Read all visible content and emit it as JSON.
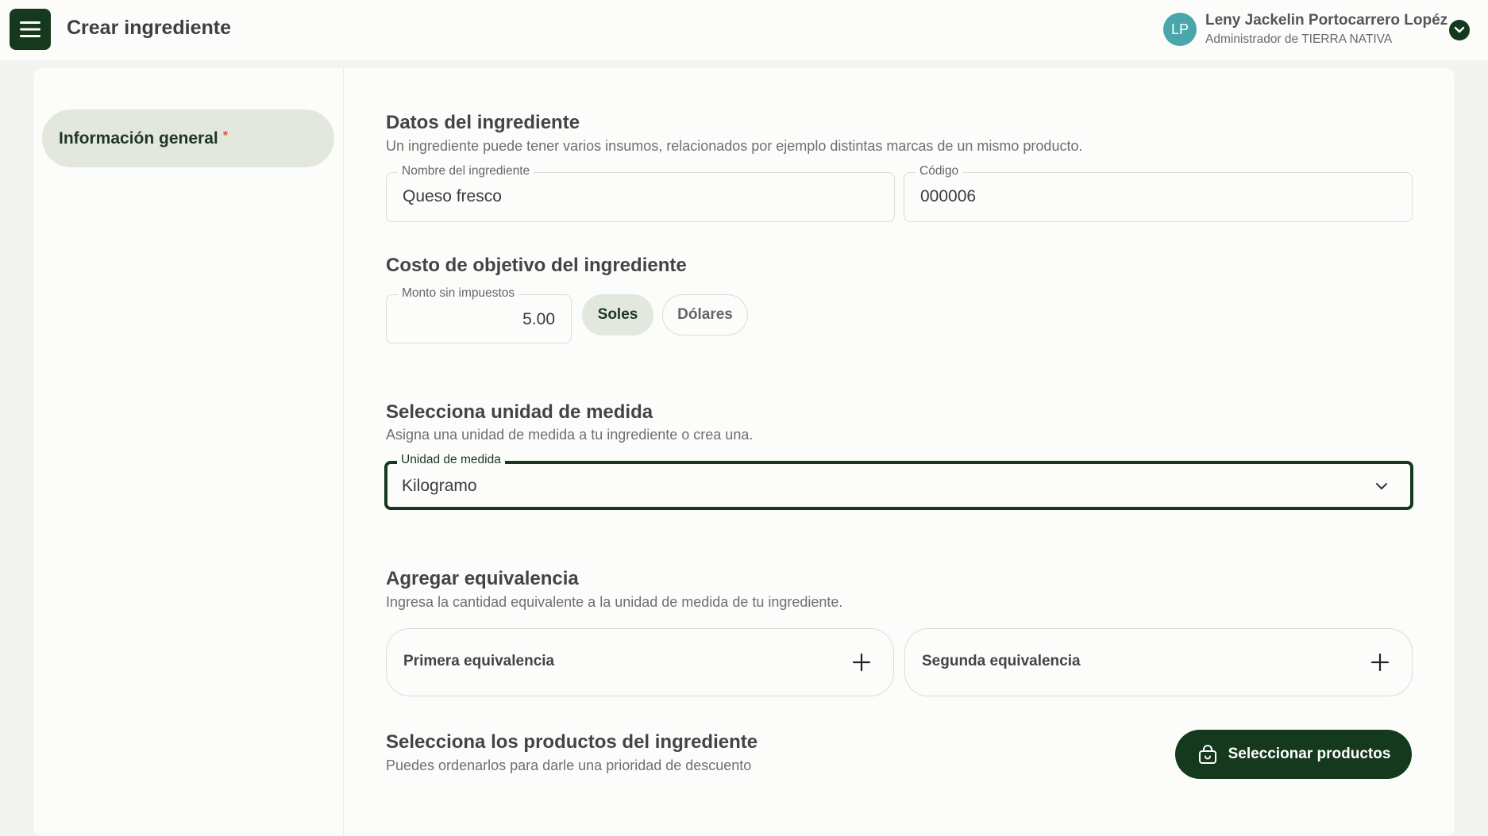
{
  "header": {
    "title": "Crear ingrediente",
    "user": {
      "initials": "LP",
      "name": "Leny Jackelin Portocarrero Lopéz",
      "role": "Administrador de TIERRA NATIVA"
    }
  },
  "sidebar": {
    "items": [
      {
        "label": "Información general",
        "required_mark": "*"
      }
    ]
  },
  "sections": {
    "datos": {
      "title": "Datos del ingrediente",
      "subtitle": "Un ingrediente puede tener varios insumos, relacionados por ejemplo distintas marcas de un mismo producto.",
      "nombre": {
        "label": "Nombre del ingrediente",
        "value": "Queso fresco"
      },
      "codigo": {
        "label": "Código",
        "value": "000006"
      }
    },
    "costo": {
      "title": "Costo de objetivo del ingrediente",
      "monto": {
        "label": "Monto sin impuestos",
        "value": "5.00"
      },
      "currency_options": [
        "Soles",
        "Dólares"
      ],
      "selected_currency": "Soles"
    },
    "unidad": {
      "title": "Selecciona unidad de medida",
      "subtitle": "Asigna una unidad de medida a tu ingrediente o crea una.",
      "select": {
        "label": "Unidad de medida",
        "value": "Kilogramo"
      }
    },
    "equivalencia": {
      "title": "Agregar equivalencia",
      "subtitle": "Ingresa la cantidad equivalente a la unidad de medida de tu ingrediente.",
      "first": "Primera equivalencia",
      "second": "Segunda equivalencia"
    },
    "productos": {
      "title": "Selecciona los productos del ingrediente",
      "subtitle": "Puedes ordenarlos para darle una prioridad de descuento",
      "button": "Seleccionar productos"
    }
  },
  "colors": {
    "primary": "#15391c",
    "active_bg": "#e3e8df",
    "avatar": "#49a7ac",
    "required": "#e0523f"
  },
  "icons": [
    "menu-icon",
    "chevron-down-icon",
    "plus-icon",
    "shopping-bag-icon"
  ]
}
